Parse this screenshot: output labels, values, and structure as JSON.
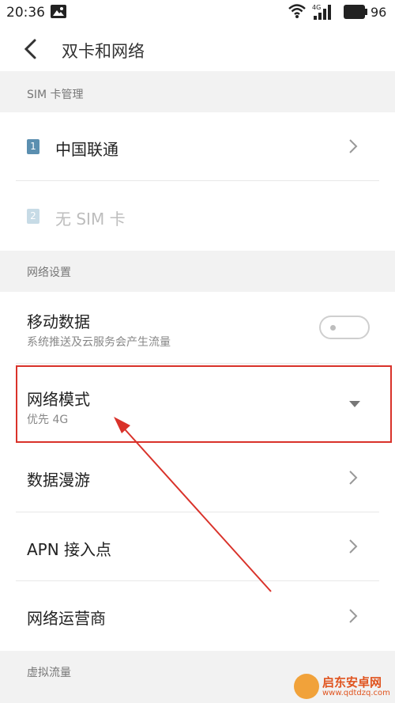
{
  "status_bar": {
    "time": "20:36",
    "network_label": "4G",
    "battery_level": "96",
    "icons": [
      "image-icon",
      "wifi-icon",
      "cell-signal-icon",
      "battery-icon"
    ]
  },
  "title_bar": {
    "back_icon": "chevron-left-icon",
    "title": "双卡和网络"
  },
  "sim_section": {
    "header": "SIM 卡管理",
    "sim1": {
      "badge": "1",
      "name": "中国联通",
      "badge_color": "#5b8fb0",
      "enabled": true
    },
    "sim2": {
      "badge": "2",
      "name": "无 SIM 卡",
      "badge_color": "#c7dbe6",
      "enabled": false
    }
  },
  "network_section": {
    "header": "网络设置",
    "mobile_data": {
      "label": "移动数据",
      "subtitle": "系统推送及云服务会产生流量",
      "toggle_on": false
    },
    "network_mode": {
      "label": "网络模式",
      "value": "优先 4G",
      "icon": "dropdown-triangle-icon"
    },
    "data_roaming": {
      "label": "数据漫游"
    },
    "apn": {
      "label": "APN 接入点"
    },
    "operator": {
      "label": "网络运营商"
    }
  },
  "virtual_section": {
    "header": "虚拟流量"
  },
  "annotation": {
    "highlight_color": "#d9322a"
  },
  "watermark": {
    "text": "启东安卓网",
    "url": "www.qdtdzq.com"
  }
}
